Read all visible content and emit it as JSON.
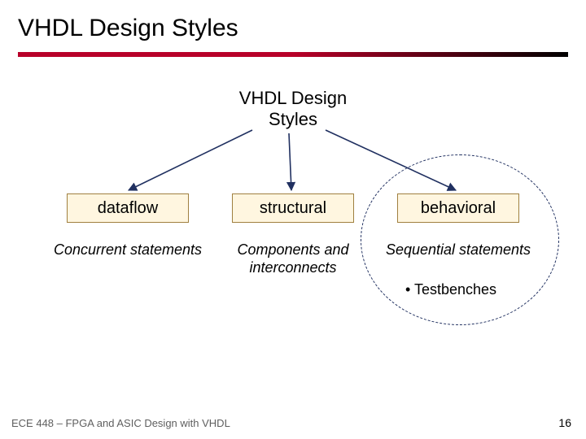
{
  "title": "VHDL Design Styles",
  "root": {
    "line1": "VHDL Design",
    "line2": "Styles"
  },
  "boxes": {
    "dataflow": "dataflow",
    "structural": "structural",
    "behavioral": "behavioral"
  },
  "descriptions": {
    "dataflow": "Concurrent statements",
    "structural": "Components and interconnects",
    "behavioral": "Sequential statements"
  },
  "bullet": "• Testbenches",
  "footer": "ECE 448 – FPGA and ASIC Design with VHDL",
  "page": "16",
  "chart_data": {
    "type": "diagram",
    "title": "VHDL Design Styles",
    "root": "VHDL Design Styles",
    "children": [
      {
        "name": "dataflow",
        "description": "Concurrent statements"
      },
      {
        "name": "structural",
        "description": "Components and interconnects"
      },
      {
        "name": "behavioral",
        "description": "Sequential statements",
        "notes": [
          "Testbenches"
        ],
        "highlighted": true
      }
    ]
  }
}
